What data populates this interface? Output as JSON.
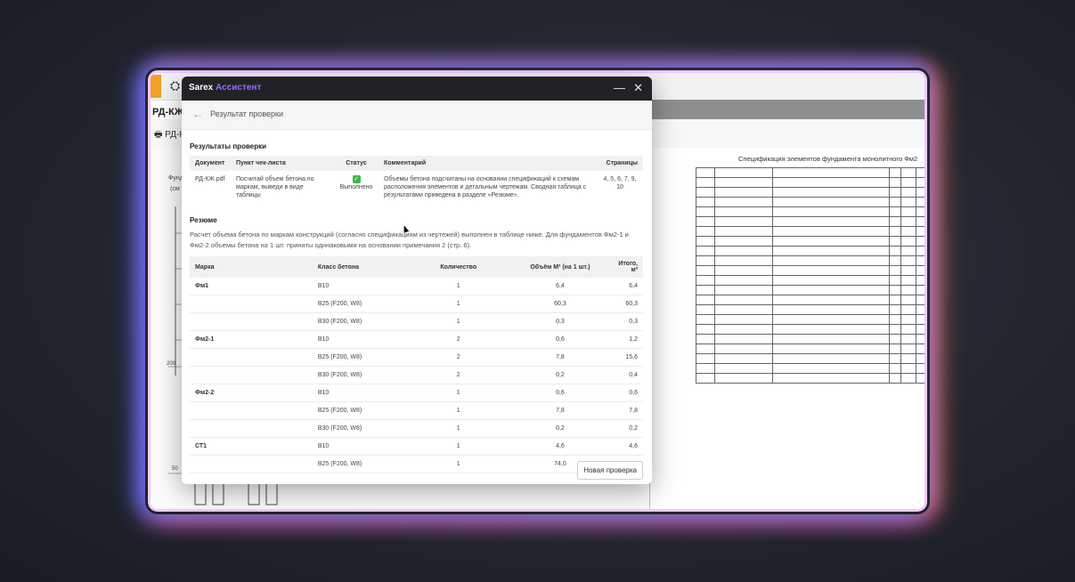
{
  "background_app": {
    "file_title": "РД-КЖ.p",
    "print_label": "РД-К",
    "spec_title": "Спецификация элементов фундамента монолитного Фм2",
    "left_label_1": "Фунд",
    "left_label_2": "(см Т",
    "left_dim_1": "200",
    "left_dim_2": "50"
  },
  "dialog": {
    "brand": "Sarex",
    "brand_accent": "Ассистент",
    "minimize_label": "—",
    "close_label": "✕",
    "back_label": "←",
    "title": "Результат проверки",
    "results_heading": "Результаты проверки",
    "check_table": {
      "headers": [
        "Документ",
        "Пункт чек-листа",
        "Статус",
        "Комментарий",
        "Страницы"
      ],
      "row": {
        "document": "РД-КЖ.pdf",
        "item": "Посчитай объем бетона по маркам, выведи в виде таблицы",
        "status": "Выполнено",
        "comment": "Объемы бетона подсчитаны на основании спецификаций к схемам расположения элементов и детальным чертежам. Сводная таблица с результатами приведена в разделе «Резюме».",
        "pages": "4, 5, 6, 7, 9, 10"
      }
    },
    "summary_heading": "Резюме",
    "summary_text": "Расчет объема бетона по маркам конструкций (согласно спецификациям из чертежей) выполнен в таблице ниже. Для фундаментов Фм2-1 и Фм2-2 объемы бетона на 1 шт. приняты одинаковыми на основании примечания 2 (стр. 6).",
    "result_table": {
      "headers": [
        "Марка",
        "Класс бетона",
        "Количество",
        "Объём М³ (на 1 шт.)",
        "Итого, м³"
      ],
      "rows": [
        {
          "mark": "Фм1",
          "class": "B10",
          "qty": "1",
          "vol": "6,4",
          "total": "6,4"
        },
        {
          "mark": "",
          "class": "B25 (F200, W8)",
          "qty": "1",
          "vol": "60,3",
          "total": "60,3"
        },
        {
          "mark": "",
          "class": "B30 (F200, W8)",
          "qty": "1",
          "vol": "0,3",
          "total": "0,3"
        },
        {
          "mark": "Фм2-1",
          "class": "B10",
          "qty": "2",
          "vol": "0,6",
          "total": "1,2"
        },
        {
          "mark": "",
          "class": "B25 (F200, W8)",
          "qty": "2",
          "vol": "7,8",
          "total": "15,6"
        },
        {
          "mark": "",
          "class": "B30 (F200, W8)",
          "qty": "2",
          "vol": "0,2",
          "total": "0,4"
        },
        {
          "mark": "Фм2-2",
          "class": "B10",
          "qty": "1",
          "vol": "0,6",
          "total": "0,6"
        },
        {
          "mark": "",
          "class": "B25 (F200, W8)",
          "qty": "1",
          "vol": "7,8",
          "total": "7,8"
        },
        {
          "mark": "",
          "class": "B30 (F200, W8)",
          "qty": "1",
          "vol": "0,2",
          "total": "0,2"
        },
        {
          "mark": "СТ1",
          "class": "B10",
          "qty": "1",
          "vol": "4,6",
          "total": "4,6"
        },
        {
          "mark": "",
          "class": "B25 (F200, W8)",
          "qty": "1",
          "vol": "74,0",
          "total": "74,0"
        }
      ]
    },
    "new_check_label": "Новая проверка"
  },
  "colors": {
    "accent": "#9b6cff",
    "header_bg": "#212227",
    "status_ok": "#41b34c"
  }
}
